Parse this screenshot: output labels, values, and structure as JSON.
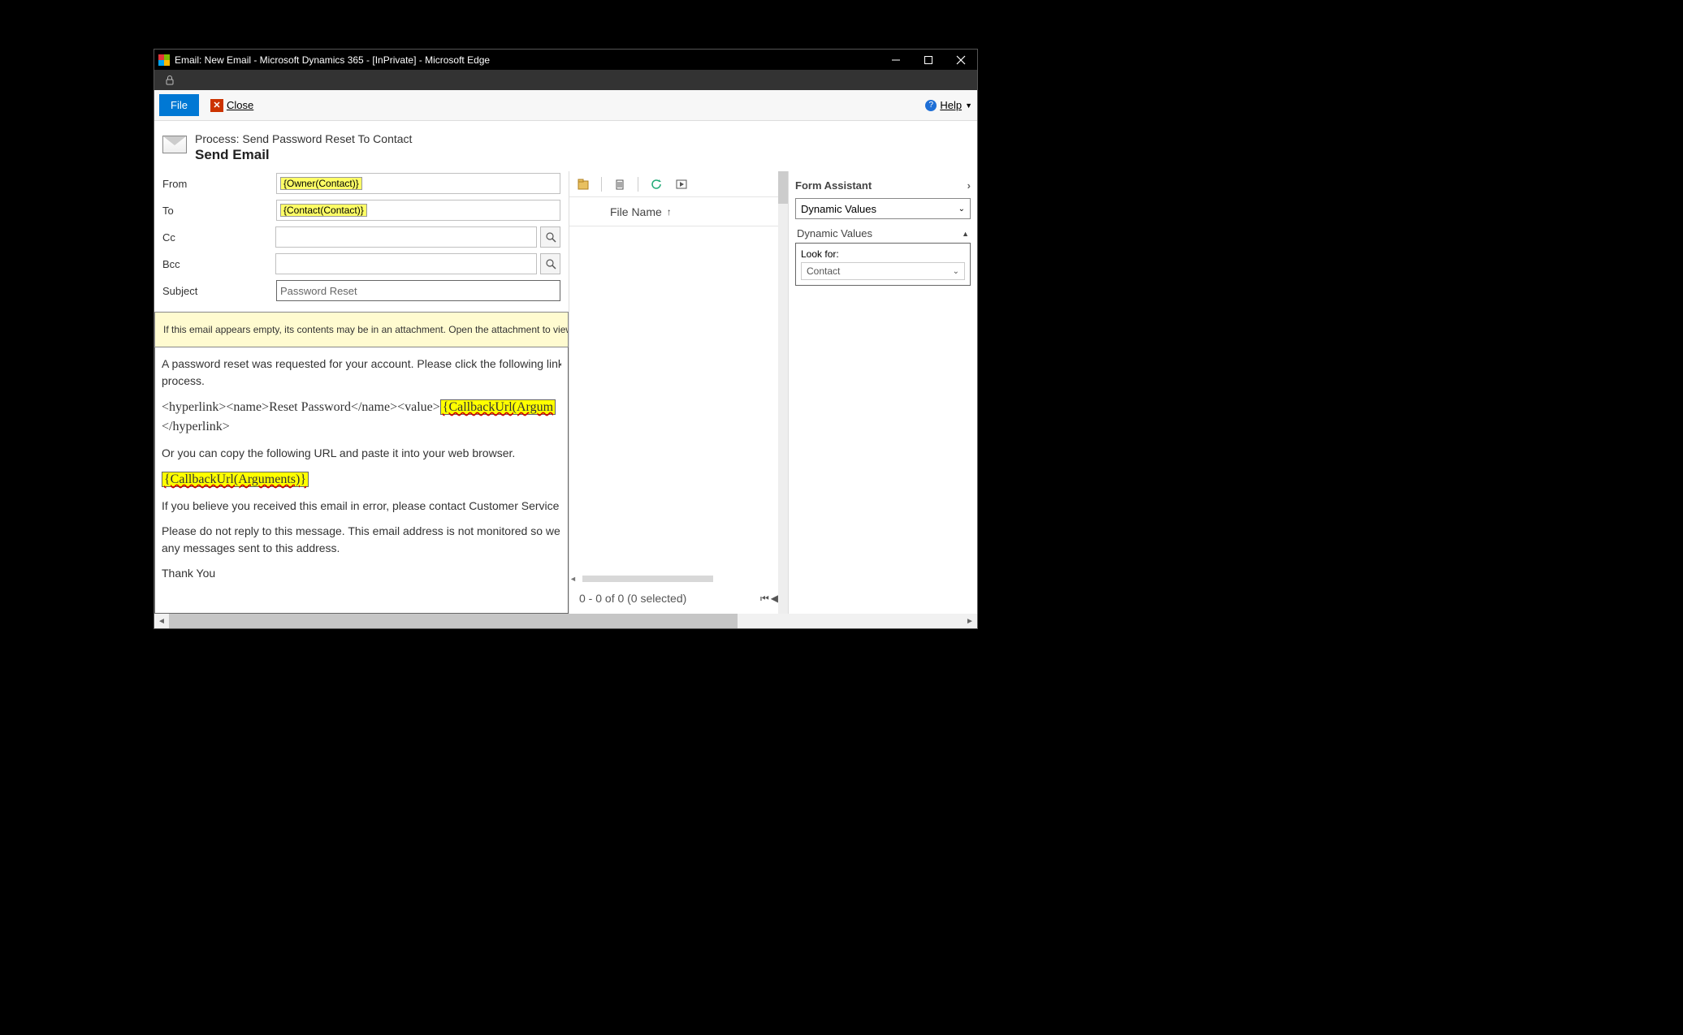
{
  "window": {
    "title": "Email: New Email - Microsoft Dynamics 365 - [InPrivate] - Microsoft Edge"
  },
  "ribbon": {
    "file_label": "File",
    "close_label": "Close",
    "help_label": "Help"
  },
  "header": {
    "process_line": "Process: Send Password Reset To Contact",
    "action_title": "Send Email"
  },
  "fields": {
    "from_label": "From",
    "from_value": "{Owner(Contact)}",
    "to_label": "To",
    "to_value": "{Contact(Contact)}",
    "cc_label": "Cc",
    "bcc_label": "Bcc",
    "subject_label": "Subject",
    "subject_value": "Password Reset"
  },
  "banner": {
    "text": "If this email appears empty, its contents may be in an attachment. Open the attachment to view the"
  },
  "body": {
    "p1": "A password reset was requested for your account. Please click the following link to complete the process.",
    "p1_visible_2": "process.",
    "hyper_prefix": "<hyperlink><name>Reset Password</name><value>",
    "hyper_token": "{CallbackUrl(Argum",
    "hyper_close": "</hyperlink>",
    "p3": "Or you can copy the following URL and paste it into your web browser.",
    "cb_token": "{CallbackUrl(Arguments)}",
    "p5": "If you believe you received this email in error, please contact Customer Service for",
    "p6": "Please do not reply to this message. This email address is not monitored so we are unable to respond to any messages sent to this address.",
    "p6_visible_2": "any messages sent to this address.",
    "p7": "Thank You"
  },
  "attachments": {
    "column_header": "File Name",
    "status": "0 - 0 of 0 (0 selected)"
  },
  "form_assistant": {
    "title": "Form Assistant",
    "dropdown_value": "Dynamic Values",
    "section_header": "Dynamic Values",
    "lookfor_label": "Look for:",
    "lookfor_value": "Contact"
  }
}
